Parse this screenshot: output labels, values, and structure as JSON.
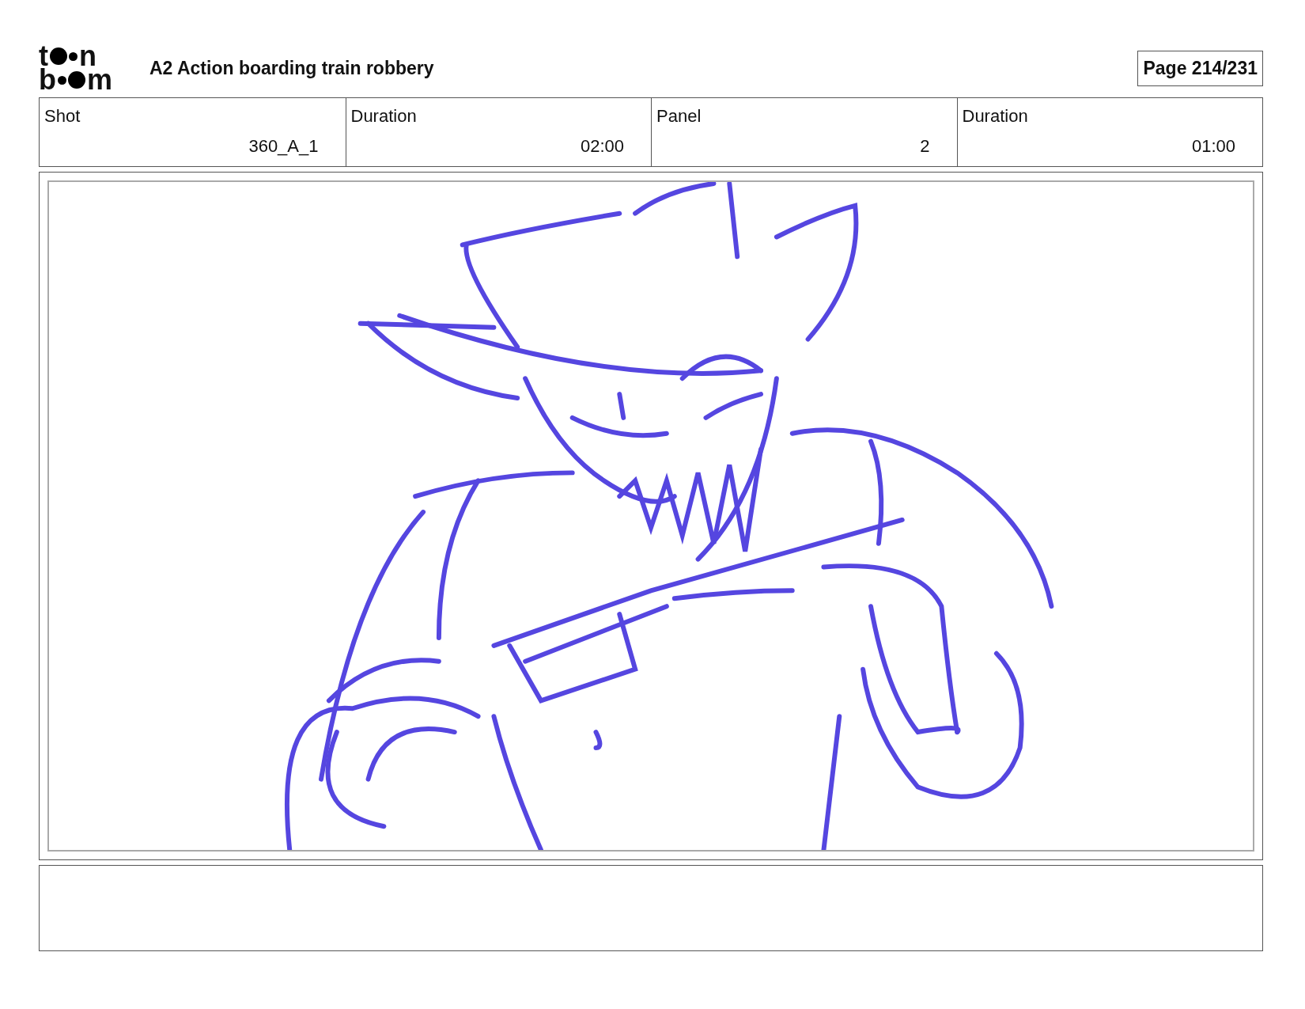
{
  "logo": {
    "lines": [
      {
        "first": "t",
        "last": "n",
        "big_dot_first": true
      },
      {
        "first": "b",
        "last": "m",
        "big_dot_first": false
      }
    ]
  },
  "title": "A2 Action boarding train robbery",
  "page": "Page 214/231",
  "fields": [
    {
      "label": "Shot",
      "value": "360_A_1"
    },
    {
      "label": "Duration",
      "value": "02:00"
    },
    {
      "label": "Panel",
      "value": "2"
    },
    {
      "label": "Duration",
      "value": "01:00"
    }
  ]
}
